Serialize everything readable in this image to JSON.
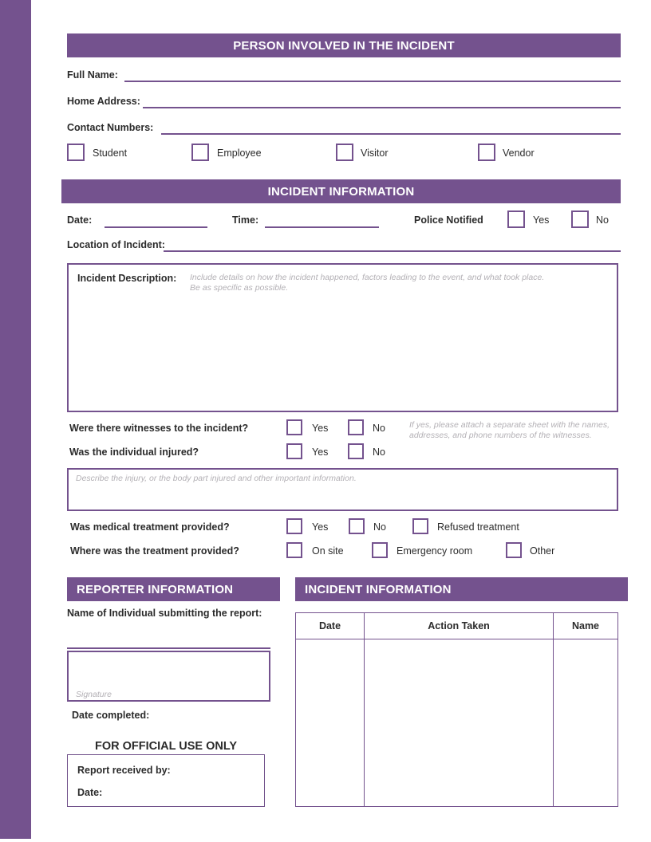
{
  "theme": {
    "purple": "#74528e",
    "text": "#2b2b2b",
    "hint": "#b3b0b5"
  },
  "person_section": {
    "header": "PERSON INVOLVED IN THE INCIDENT",
    "fields": [
      {
        "label": "Full Name:"
      },
      {
        "label": "Home Address:"
      },
      {
        "label": "Contact Numbers:"
      }
    ],
    "role_options": [
      {
        "label": "Student"
      },
      {
        "label": "Employee"
      },
      {
        "label": "Visitor"
      },
      {
        "label": "Vendor"
      }
    ]
  },
  "incident_section": {
    "header": "INCIDENT INFORMATION",
    "date_label": "Date:",
    "time_label": "Time:",
    "police_label": "Police Notified",
    "police_yes": "Yes",
    "police_no": "No",
    "location_label": "Location of Incident:",
    "description_label": "Incident Description:",
    "description_hint": "Include details on how the incident happened, factors leading to the event, and what took place.\nBe as specific as possible.",
    "witness_question": "Were there witnesses to the incident?",
    "witness_yes": "Yes",
    "witness_no": "No",
    "witness_note": "If yes, please attach a separate sheet with the names,\naddresses, and phone numbers of the witnesses.",
    "injury_question": "Was the individual injured?",
    "injury_yes": "Yes",
    "injury_no": "No",
    "injury_hint": "Describe the injury, or the body part injured and other important information.",
    "treatment_question": "Was medical treatment provided?",
    "treatment_yes": "Yes",
    "treatment_no": "No",
    "treatment_refused": "Refused treatment",
    "where_question": "Where was the treatment provided?",
    "where_onsite": "On site",
    "where_er": "Emergency room",
    "where_other": "Other"
  },
  "reporter_section": {
    "header": "REPORTER INFORMATION",
    "name_label": "Name of Individual submitting the report:",
    "signature_hint": "Signature",
    "date_completed_label": "Date completed:"
  },
  "official_section": {
    "title": "FOR OFFICIAL USE ONLY",
    "received_by_label": "Report received by:",
    "date_label": "Date:"
  },
  "action_table": {
    "header": "INCIDENT INFORMATION",
    "columns": [
      "Date",
      "Action Taken",
      "Name"
    ],
    "rows": []
  }
}
